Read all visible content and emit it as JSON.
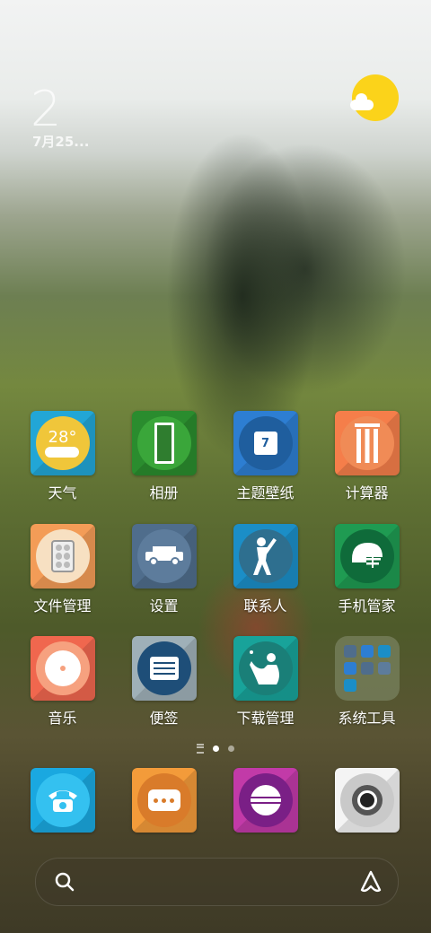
{
  "status": {
    "clock_partial": "2",
    "date_partial": "7月25..."
  },
  "apps_row1": [
    {
      "label": "天气",
      "icon": "weather-icon",
      "color": "#22a6d6",
      "disc": "#f0c63a",
      "text": "28°"
    },
    {
      "label": "相册",
      "icon": "gallery-icon",
      "color": "#2a8c2e",
      "disc": "#3aa63a"
    },
    {
      "label": "主题壁纸",
      "icon": "jersey-icon",
      "color": "#2d7ed2",
      "disc": "#1f5e9e",
      "text": "7"
    },
    {
      "label": "计算器",
      "icon": "cricket-stumps-icon",
      "color": "#f57e4a",
      "disc": "#f08b56"
    }
  ],
  "apps_row2": [
    {
      "label": "文件管理",
      "icon": "pills-icon",
      "color": "#f39c57",
      "disc": "#f7e0c2"
    },
    {
      "label": "设置",
      "icon": "jeep-icon",
      "color": "#4f6d8c",
      "disc": "#5d7c9c"
    },
    {
      "label": "联系人",
      "icon": "batsman-icon",
      "color": "#1b8ec7",
      "disc": "#2e6f8f"
    },
    {
      "label": "手机管家",
      "icon": "helmet-icon",
      "color": "#1f9b52",
      "disc": "#0f6b3a"
    }
  ],
  "apps_row3": [
    {
      "label": "音乐",
      "icon": "music-disc-icon",
      "color": "#f0674e",
      "disc": "#f6a17f"
    },
    {
      "label": "便签",
      "icon": "notes-icon",
      "color": "#9fb0b8",
      "disc": "#1e4e78"
    },
    {
      "label": "下载管理",
      "icon": "fielder-icon",
      "color": "#18a39a",
      "disc": "#1a7f78"
    },
    {
      "label": "系统工具",
      "icon": "folder-icon",
      "color": "#6e7a52"
    }
  ],
  "dock": [
    {
      "name": "phone",
      "icon": "phone-icon",
      "color": "#1aa8e0",
      "disc": "#34c1f0"
    },
    {
      "name": "messages",
      "icon": "message-icon",
      "color": "#f39b3a",
      "disc": "#d97b2a"
    },
    {
      "name": "browser",
      "icon": "cricket-ball-icon",
      "color": "#c23aa8",
      "disc": "#7a1f86"
    },
    {
      "name": "camera",
      "icon": "camera-icon",
      "color": "#f4f4f4",
      "disc": "#c9c9c9"
    }
  ],
  "search": {
    "icon": "search-icon",
    "assistant_icon": "assistant-icon"
  }
}
